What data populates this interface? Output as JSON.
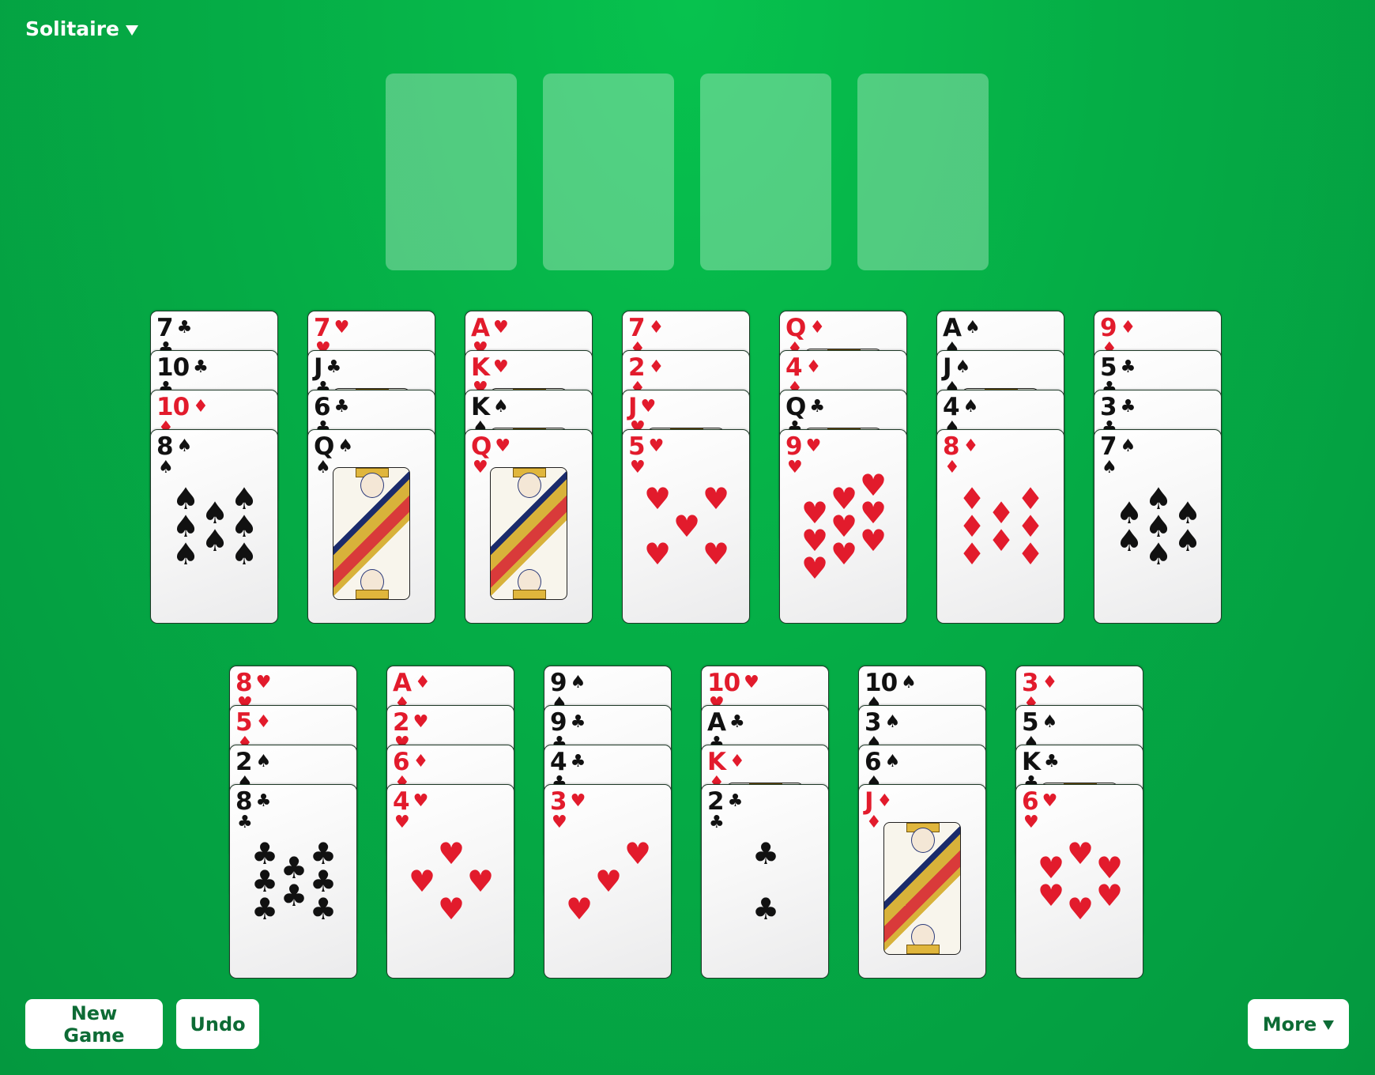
{
  "header": {
    "title": "Solitaire",
    "menu_icon": "triangle-down-icon"
  },
  "foundations": [
    {
      "label": "",
      "cards": []
    },
    {
      "label": "",
      "cards": []
    },
    {
      "label": "",
      "cards": []
    },
    {
      "label": "",
      "cards": []
    }
  ],
  "tableau_top": [
    {
      "cards": [
        {
          "rank": "7",
          "suit": "clubs"
        },
        {
          "rank": "10",
          "suit": "clubs"
        },
        {
          "rank": "10",
          "suit": "diamonds"
        },
        {
          "rank": "8",
          "suit": "spades"
        }
      ]
    },
    {
      "cards": [
        {
          "rank": "7",
          "suit": "hearts"
        },
        {
          "rank": "J",
          "suit": "clubs"
        },
        {
          "rank": "6",
          "suit": "clubs"
        },
        {
          "rank": "Q",
          "suit": "spades"
        }
      ]
    },
    {
      "cards": [
        {
          "rank": "A",
          "suit": "hearts"
        },
        {
          "rank": "K",
          "suit": "hearts"
        },
        {
          "rank": "K",
          "suit": "spades"
        },
        {
          "rank": "Q",
          "suit": "hearts"
        }
      ]
    },
    {
      "cards": [
        {
          "rank": "7",
          "suit": "diamonds"
        },
        {
          "rank": "2",
          "suit": "diamonds"
        },
        {
          "rank": "J",
          "suit": "hearts"
        },
        {
          "rank": "5",
          "suit": "hearts"
        }
      ]
    },
    {
      "cards": [
        {
          "rank": "Q",
          "suit": "diamonds"
        },
        {
          "rank": "4",
          "suit": "diamonds"
        },
        {
          "rank": "Q",
          "suit": "clubs"
        },
        {
          "rank": "9",
          "suit": "hearts"
        }
      ]
    },
    {
      "cards": [
        {
          "rank": "A",
          "suit": "spades"
        },
        {
          "rank": "J",
          "suit": "spades"
        },
        {
          "rank": "4",
          "suit": "spades"
        },
        {
          "rank": "8",
          "suit": "diamonds"
        }
      ]
    },
    {
      "cards": [
        {
          "rank": "9",
          "suit": "diamonds"
        },
        {
          "rank": "5",
          "suit": "clubs"
        },
        {
          "rank": "3",
          "suit": "clubs"
        },
        {
          "rank": "7",
          "suit": "spades"
        }
      ]
    }
  ],
  "tableau_bottom": [
    {
      "cards": [
        {
          "rank": "8",
          "suit": "hearts"
        },
        {
          "rank": "5",
          "suit": "diamonds"
        },
        {
          "rank": "2",
          "suit": "spades"
        },
        {
          "rank": "8",
          "suit": "clubs"
        }
      ]
    },
    {
      "cards": [
        {
          "rank": "A",
          "suit": "diamonds"
        },
        {
          "rank": "2",
          "suit": "hearts"
        },
        {
          "rank": "6",
          "suit": "diamonds"
        },
        {
          "rank": "4",
          "suit": "hearts"
        }
      ]
    },
    {
      "cards": [
        {
          "rank": "9",
          "suit": "spades"
        },
        {
          "rank": "9",
          "suit": "clubs"
        },
        {
          "rank": "4",
          "suit": "clubs"
        },
        {
          "rank": "3",
          "suit": "hearts"
        }
      ]
    },
    {
      "cards": [
        {
          "rank": "10",
          "suit": "hearts"
        },
        {
          "rank": "A",
          "suit": "clubs"
        },
        {
          "rank": "K",
          "suit": "diamonds"
        },
        {
          "rank": "2",
          "suit": "clubs"
        }
      ]
    },
    {
      "cards": [
        {
          "rank": "10",
          "suit": "spades"
        },
        {
          "rank": "3",
          "suit": "spades"
        },
        {
          "rank": "6",
          "suit": "spades"
        },
        {
          "rank": "J",
          "suit": "diamonds"
        }
      ]
    },
    {
      "cards": [
        {
          "rank": "3",
          "suit": "diamonds"
        },
        {
          "rank": "5",
          "suit": "spades"
        },
        {
          "rank": "K",
          "suit": "clubs"
        },
        {
          "rank": "6",
          "suit": "hearts"
        }
      ]
    }
  ],
  "suits": {
    "hearts": {
      "glyph": "♥",
      "color": "#e21b2c"
    },
    "diamonds": {
      "glyph": "♦",
      "color": "#e21b2c"
    },
    "clubs": {
      "glyph": "♣",
      "color": "#111111"
    },
    "spades": {
      "glyph": "♠",
      "color": "#111111"
    }
  },
  "toolbar": {
    "new_game_label": "New Game",
    "undo_label": "Undo",
    "more_label": "More"
  },
  "colors": {
    "felt": "#05ad46",
    "button_text": "#0d6b35"
  }
}
